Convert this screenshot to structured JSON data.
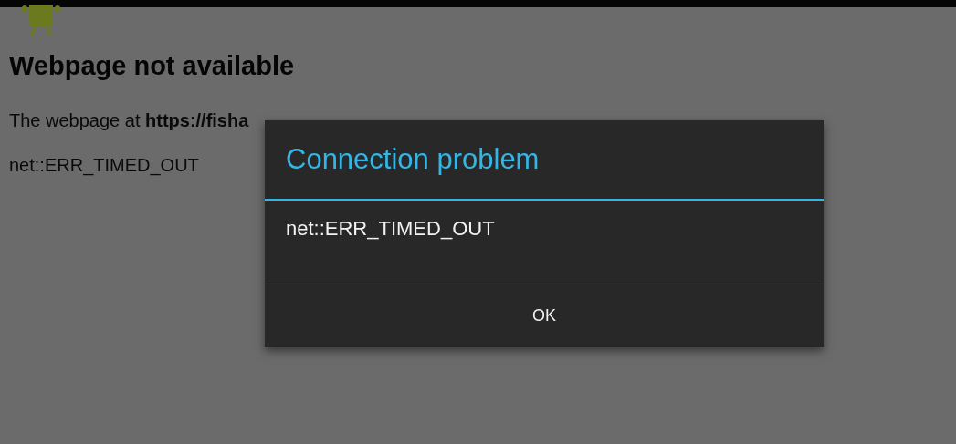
{
  "page": {
    "title": "Webpage not available",
    "message": "The webpage at **https://fisha**",
    "error": "net::ERR_TIMED_OUT"
  },
  "dialog": {
    "title": "Connection problem",
    "message": "net::ERR_TIMED_OUT",
    "buttons": [
      "OK"
    ]
  }
}
